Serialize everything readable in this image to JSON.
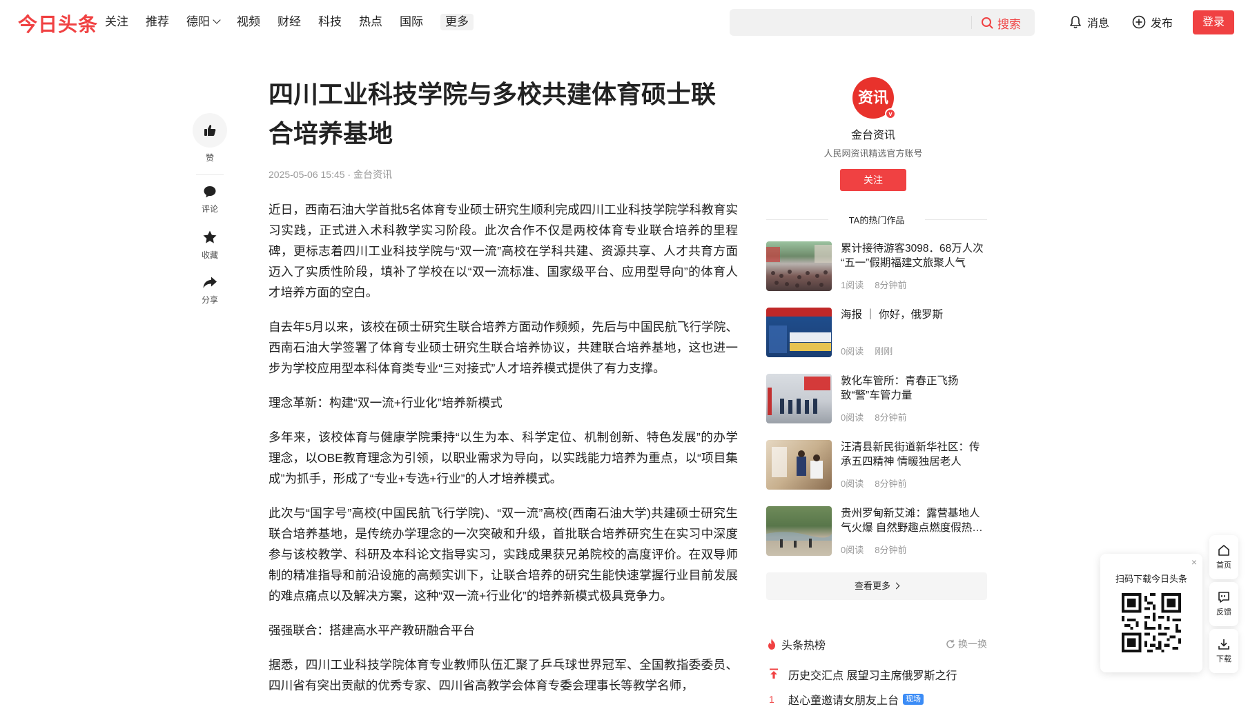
{
  "header": {
    "logo": "今日头条",
    "nav": [
      "关注",
      "推荐",
      "德阳",
      "视频",
      "财经",
      "科技",
      "热点",
      "国际"
    ],
    "nav_more": "更多",
    "search_placeholder": "",
    "search_label": "搜索",
    "messages_label": "消息",
    "publish_label": "发布",
    "login_label": "登录"
  },
  "rail": {
    "like": "赞",
    "comment": "评论",
    "favorite": "收藏",
    "share": "分享"
  },
  "article": {
    "title": "四川工业科技学院与多校共建体育硕士联合培养基地",
    "meta": "2025-05-06 15:45 · 金台资讯",
    "paragraphs": [
      "近日，西南石油大学首批5名体育专业硕士研究生顺利完成四川工业科技学院学科教育实习实践，正式进入术科教学实习阶段。此次合作不仅是两校体育专业联合培养的里程碑，更标志着四川工业科技学院与“双一流”高校在学科共建、资源共享、人才共育方面迈入了实质性阶段，填补了学校在以“双一流标准、国家级平台、应用型导向”的体育人才培养方面的空白。",
      "自去年5月以来，该校在硕士研究生联合培养方面动作频频，先后与中国民航飞行学院、西南石油大学签署了体育专业硕士研究生联合培养协议，共建联合培养基地，这也进一步为学校应用型本科体育类专业“三对接式”人才培养模式提供了有力支撑。",
      "理念革新：构建“双一流+行业化”培养新模式",
      "多年来，该校体育与健康学院秉持“以生为本、科学定位、机制创新、特色发展”的办学理念，以OBE教育理念为引领，以职业需求为导向，以实践能力培养为重点，以“项目集成”为抓手，形成了“专业+专选+行业”的人才培养模式。",
      "此次与“国字号”高校(中国民航飞行学院)、“双一流”高校(西南石油大学)共建硕士研究生联合培养基地，是传统办学理念的一次突破和升级，首批联合培养研究生在实习中深度参与该校教学、科研及本科论文指导实习，实践成果获兄弟院校的高度评价。在双导师制的精准指导和前沿设施的高频实训下，让联合培养的研究生能快速掌握行业目前发展的难点痛点以及解决方案，这种“双一流+行业化”的培养新模式极具竞争力。",
      "强强联合：搭建高水平产教研融合平台",
      "据悉，四川工业科技学院体育专业教师队伍汇聚了乒乓球世界冠军、全国教指委委员、四川省有突出贡献的优秀专家、四川省高教学会体育专委会理事长等教学名师，"
    ]
  },
  "author": {
    "avatar_text": "资讯",
    "badge": "v",
    "name": "金台资讯",
    "desc": "人民网资讯精选官方账号",
    "follow_label": "关注"
  },
  "hot_works": {
    "title": "TA的热门作品",
    "items": [
      {
        "title": "累计接待游客3098．68万人次 “五一”假期福建文旅聚人气",
        "reads": "1阅读",
        "time": "8分钟前"
      },
      {
        "title": "海报 ｜ 你好，俄罗斯",
        "reads": "0阅读",
        "time": "刚刚"
      },
      {
        "title": "敦化车管所：青春正飞扬 致“警”车管力量",
        "reads": "0阅读",
        "time": "8分钟前"
      },
      {
        "title": "汪清县新民街道新华社区：传承五四精神 情暖独居老人",
        "reads": "0阅读",
        "time": "8分钟前"
      },
      {
        "title": "贵州罗甸新艾滩：露营基地人气火爆 自然野趣点燃度假热…",
        "reads": "0阅读",
        "time": "8分钟前"
      }
    ],
    "see_more": "查看更多"
  },
  "trending": {
    "title": "头条热榜",
    "refresh": "换一换",
    "items": [
      {
        "rank": "",
        "title": "历史交汇点 展望习主席俄罗斯之行",
        "tag": ""
      },
      {
        "rank": "1",
        "title": "赵心童邀请女朋友上台",
        "tag": "现场"
      }
    ]
  },
  "qr": {
    "text": "扫码下载今日头条",
    "close": "×"
  },
  "sidebar": {
    "home": "首页",
    "feedback": "反馈",
    "download": "下载"
  },
  "colors": {
    "brand_red": "#f04142",
    "text": "#222222",
    "muted": "#999999"
  }
}
